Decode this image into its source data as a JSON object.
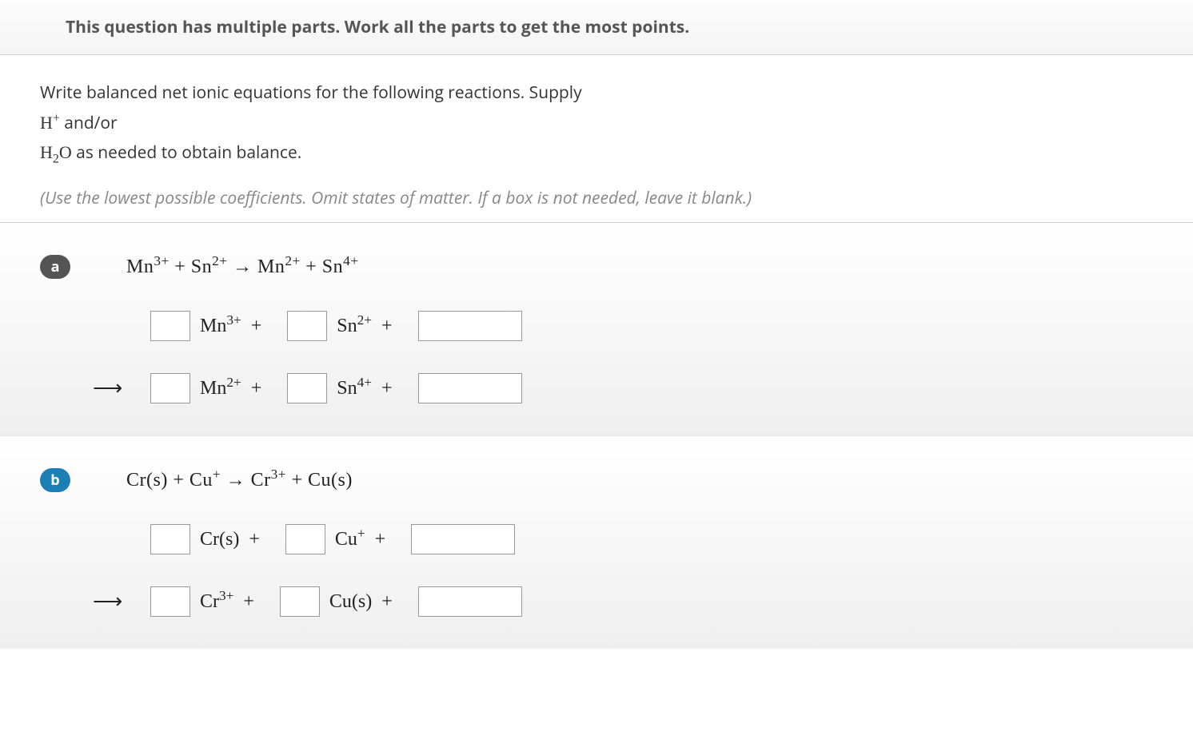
{
  "header": "This question has multiple parts. Work all the parts to get the most points.",
  "instructions": {
    "line1": "Write balanced net ionic equations for the following reactions. Supply",
    "line2_prefix": "H",
    "line2_sup": "+",
    "line2_suffix": " and/or",
    "line3_prefix": "H",
    "line3_sub": "2",
    "line3_mid": "O",
    "line3_suffix": " as needed to obtain balance."
  },
  "hint": "(Use the lowest possible coefficients. Omit states of matter. If a box is not needed, leave it blank.)",
  "parts": {
    "a": {
      "label": "a",
      "eq_parts": [
        "Mn",
        "3+",
        " + Sn",
        "2+",
        " → Mn",
        "2+",
        " + Sn",
        "4+"
      ],
      "reactants": [
        {
          "label": "Mn",
          "sup": "3+"
        },
        {
          "label": "Sn",
          "sup": "2+"
        }
      ],
      "products": [
        {
          "label": "Mn",
          "sup": "2+"
        },
        {
          "label": "Sn",
          "sup": "4+"
        }
      ]
    },
    "b": {
      "label": "b",
      "eq_text": "Cr(s) + Cu",
      "eq_sup1": "+",
      "eq_mid": " → Cr",
      "eq_sup2": "3+",
      "eq_end": " + Cu(s)",
      "reactants": [
        {
          "label": "Cr(s)",
          "sup": ""
        },
        {
          "label": "Cu",
          "sup": "+"
        }
      ],
      "products": [
        {
          "label": "Cr",
          "sup": "3+"
        },
        {
          "label": "Cu(s)",
          "sup": ""
        }
      ]
    }
  },
  "plus": "+",
  "arrow": "⟶"
}
